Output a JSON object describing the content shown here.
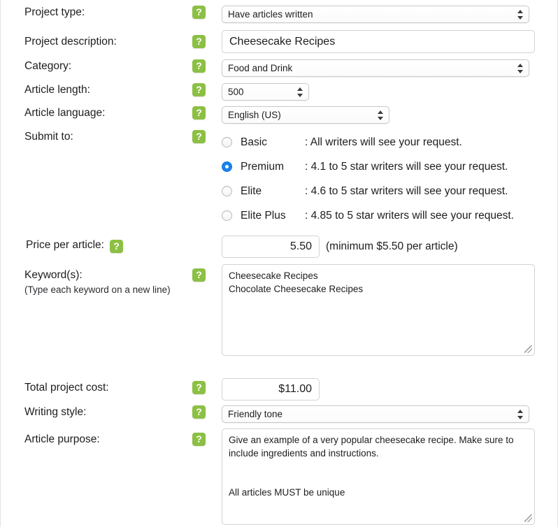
{
  "theme": {
    "help_icon_color": "#8cc044",
    "radio_selected_color": "#1a82ef",
    "text_color": "#1d1d1f",
    "border_color": "#d3d3d7"
  },
  "icons": {
    "help": "?"
  },
  "form": {
    "project_type": {
      "label": "Project type:",
      "value": "Have articles written"
    },
    "project_description": {
      "label": "Project description:",
      "value": "Cheesecake Recipes"
    },
    "category": {
      "label": "Category:",
      "value": "Food and Drink"
    },
    "article_length": {
      "label": "Article length:",
      "value": "500"
    },
    "article_language": {
      "label": "Article language:",
      "value": "English (US)"
    },
    "submit_to": {
      "label": "Submit to:",
      "options": [
        {
          "name": "Basic",
          "description": ": All writers will see your request.",
          "selected": false
        },
        {
          "name": "Premium",
          "description": ": 4.1 to 5 star writers will see your request.",
          "selected": true
        },
        {
          "name": "Elite",
          "description": ": 4.6 to 5 star writers will see your request.",
          "selected": false
        },
        {
          "name": "Elite Plus",
          "description": ": 4.85 to 5 star writers will see your request.",
          "selected": false
        }
      ]
    },
    "price_per_article": {
      "label": "Price per article:",
      "value": "5.50",
      "hint": "(minimum $5.50 per article)"
    },
    "keywords": {
      "label": "Keyword(s):",
      "sublabel": "(Type each keyword on a new line)",
      "value": "Cheesecake Recipes\nChocolate Cheesecake Recipes"
    },
    "total_project_cost": {
      "label": "Total project cost:",
      "value": "$11.00"
    },
    "writing_style": {
      "label": "Writing style:",
      "value": "Friendly tone"
    },
    "article_purpose": {
      "label": "Article purpose:",
      "value": "Give an example of a very popular cheesecake recipe. Make sure to include ingredients and instructions.\n\n\nAll articles MUST be unique"
    }
  }
}
